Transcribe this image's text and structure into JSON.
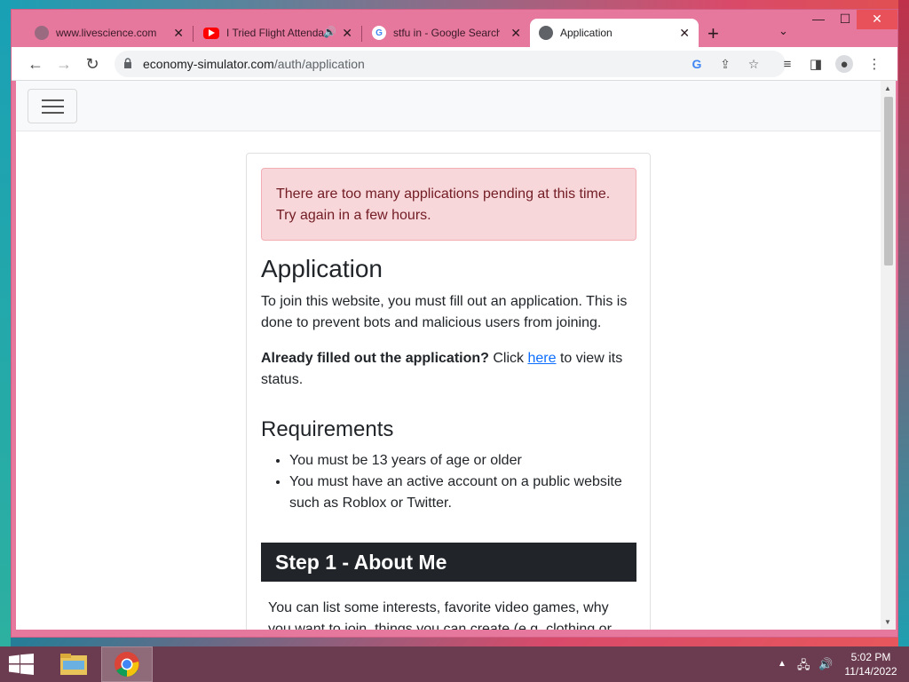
{
  "browser": {
    "tabs": [
      {
        "title": "www.livescience.com",
        "close": "✕"
      },
      {
        "title": "I Tried Flight Attenda",
        "close": "✕"
      },
      {
        "title": "stfu in - Google Search",
        "close": "✕"
      },
      {
        "title": "Application",
        "close": "✕"
      }
    ],
    "new_tab": "+",
    "tab_search": "⌄",
    "window_controls": {
      "minimize": "—",
      "maximize": "☐",
      "close": "✕"
    },
    "url_host": "economy-simulator.com",
    "url_path": "/auth/application"
  },
  "page": {
    "alert": "There are too many applications pending at this time. Try again in a few hours.",
    "heading": "Application",
    "intro": "To join this website, you must fill out an application. This is done to prevent bots and malicious users from joining.",
    "already_bold": "Already filled out the application?",
    "already_click": " Click ",
    "already_link": "here",
    "already_rest": " to view its status.",
    "requirements_heading": "Requirements",
    "requirements": [
      "You must be 13 years of age or older",
      "You must have an active account on a public website such as Roblox or Twitter."
    ],
    "step1_heading": "Step 1 - About Me",
    "step1_text": "You can list some interests, favorite video games, why you want to join, things you can create (e.g. clothing or"
  },
  "taskbar": {
    "time": "5:02 PM",
    "date": "11/14/2022"
  },
  "colors": {
    "browser_frame": "#e6779d",
    "alert_bg": "#f8d7da",
    "alert_text": "#721c24",
    "step_bg": "#212529",
    "link": "#0d6efd",
    "taskbar": "#6b3c4f"
  }
}
